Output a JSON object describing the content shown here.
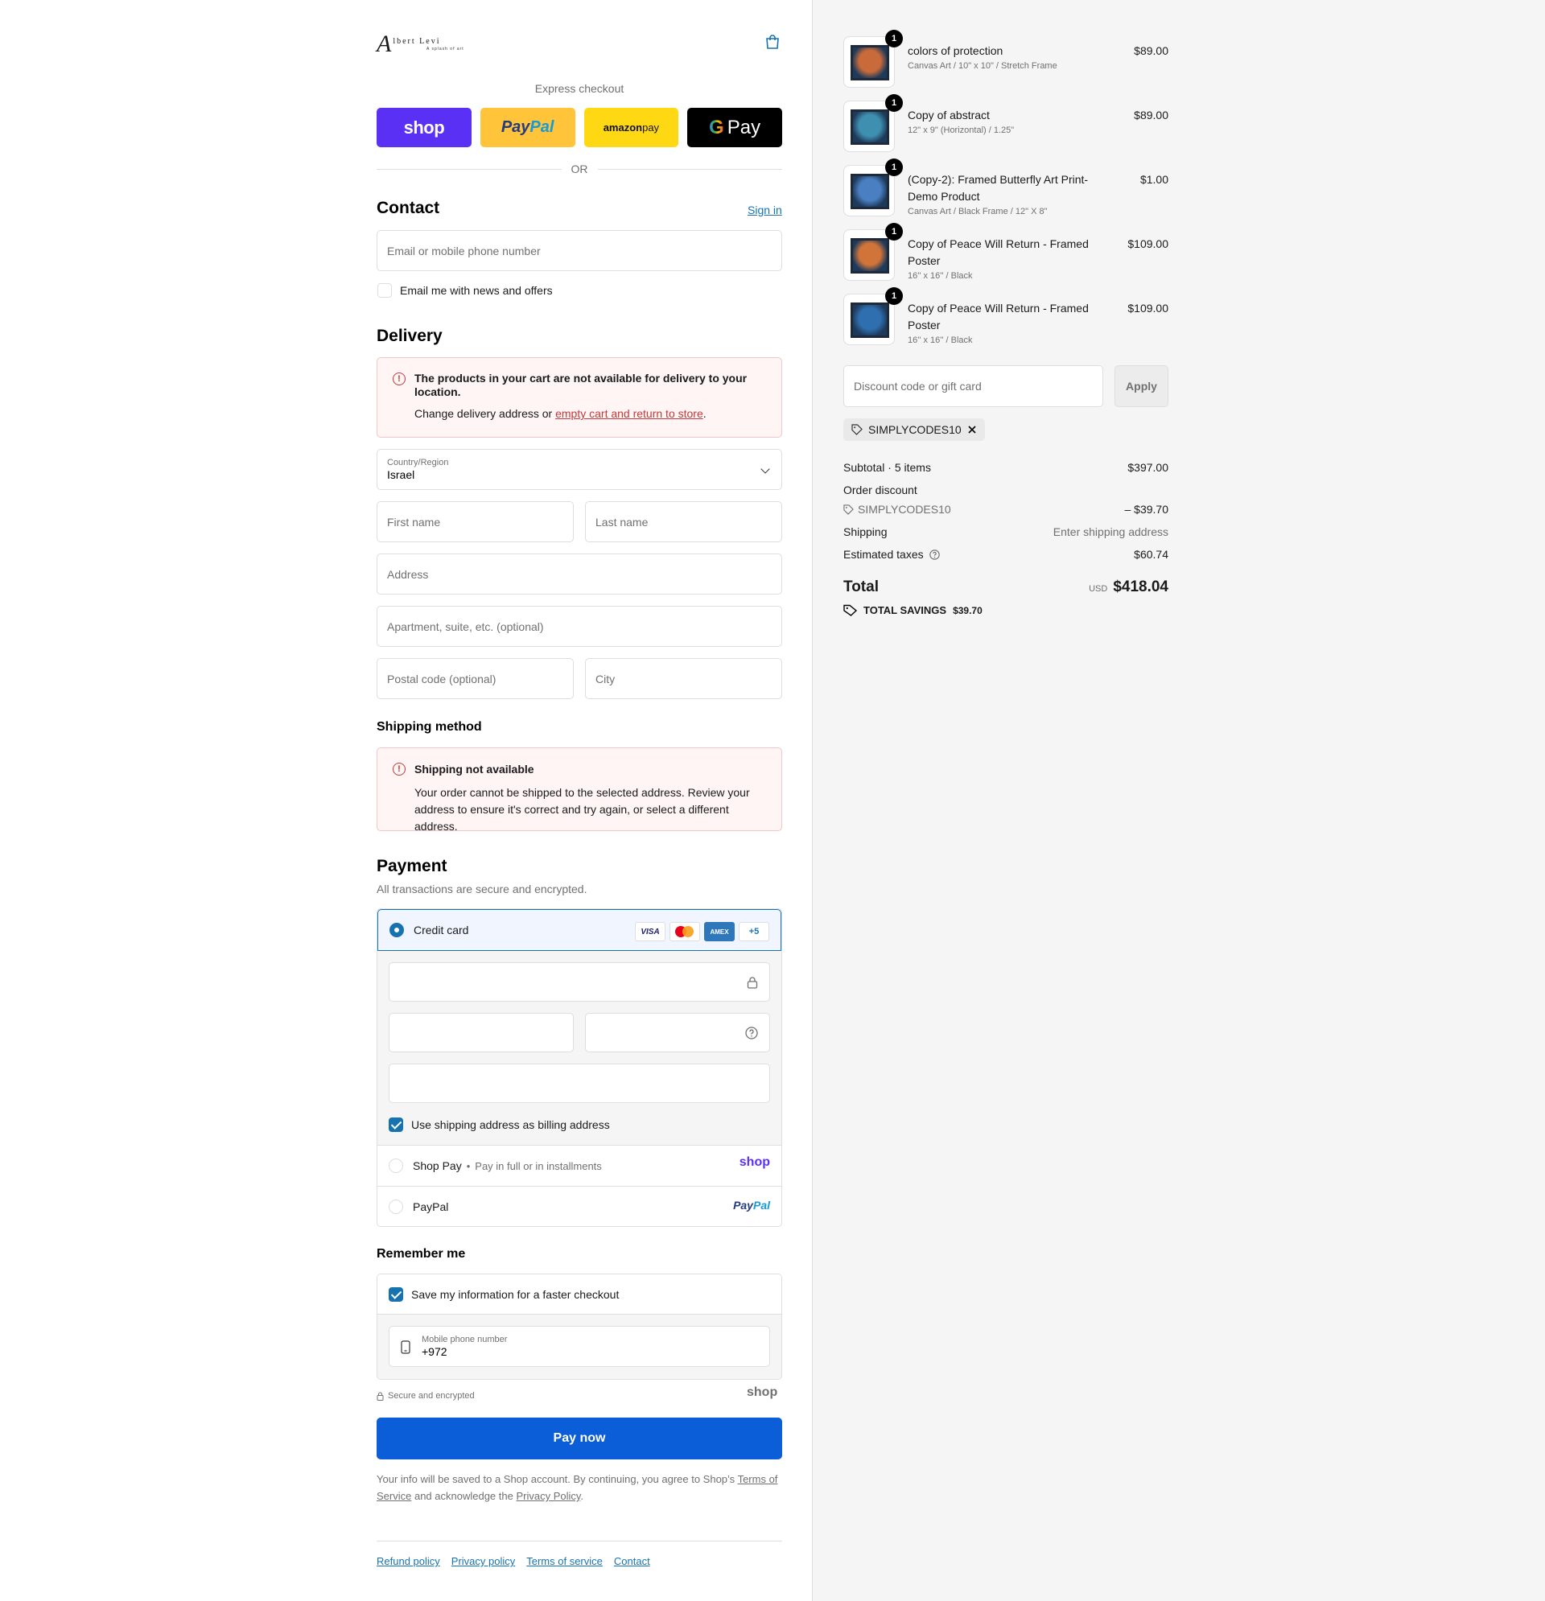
{
  "header": {
    "logo_mark": "A",
    "logo_text": "lbert Levi",
    "logo_tagline": "A splash of art"
  },
  "express": {
    "title": "Express checkout",
    "shop": "shop",
    "paypal_1": "Pay",
    "paypal_2": "Pal",
    "amazon_1": "amazon",
    "amazon_2": " pay",
    "gpay_g": "G",
    "gpay_label": "Pay",
    "or": "OR"
  },
  "contact": {
    "title": "Contact",
    "sign_in": "Sign in",
    "email_placeholder": "Email or mobile phone number",
    "newsletter": "Email me with news and offers"
  },
  "delivery": {
    "title": "Delivery",
    "alert_title": "The products in your cart are not available for delivery to your location.",
    "alert_text": "Change delivery address or ",
    "alert_link": "empty cart and return to store",
    "alert_end": ".",
    "country_label": "Country/Region",
    "country_value": "Israel",
    "first_name": "First name",
    "last_name": "Last name",
    "address": "Address",
    "apartment": "Apartment, suite, etc. (optional)",
    "postal": "Postal code (optional)",
    "city": "City"
  },
  "shipping": {
    "title": "Shipping method",
    "alert_title": "Shipping not available",
    "alert_text": "Your order cannot be shipped to the selected address. Review your address to ensure it's correct and try again, or select a different address."
  },
  "payment": {
    "title": "Payment",
    "subtitle": "All transactions are secure and encrypted.",
    "credit_card": "Credit card",
    "cards": {
      "visa": "VISA",
      "amex": "AMEX",
      "more": "+5"
    },
    "billing_same": "Use shipping address as billing address",
    "shop_pay": "Shop Pay",
    "shop_pay_sub": "Pay in full or in installments",
    "shop_pay_logo": "shop",
    "paypal": "PayPal",
    "paypal_logo_1": "Pay",
    "paypal_logo_2": "Pal"
  },
  "remember": {
    "title": "Remember me",
    "save_info": "Save my information for a faster checkout",
    "phone_label": "Mobile phone number",
    "phone_value": "+972",
    "secure": "Secure and encrypted",
    "shop_logo": "shop"
  },
  "pay_now": "Pay now",
  "legal": {
    "text_1": "Your info will be saved to a Shop account. By continuing, you agree to Shop’s ",
    "tos": "Terms of Service",
    "text_2": " and acknowledge the ",
    "privacy": "Privacy Policy",
    "text_3": "."
  },
  "footer": {
    "refund": "Refund policy",
    "privacy": "Privacy policy",
    "terms": "Terms of service",
    "contact": "Contact"
  },
  "cart": {
    "items": [
      {
        "qty": "1",
        "name": "colors of protection",
        "variant": "Canvas Art / 10\" x 10\" / Stretch Frame",
        "price": "$89.00",
        "color": "#c86a3a"
      },
      {
        "qty": "1",
        "name": "Copy of abstract",
        "variant": "12\" x 9\" (Horizontal) / 1.25\"",
        "price": "$89.00",
        "color": "#3f8fb0"
      },
      {
        "qty": "1",
        "name": "(Copy-2): Framed Butterfly Art Print- Demo Product",
        "variant": "Canvas Art / Black Frame / 12\" X 8\"",
        "price": "$1.00",
        "color": "#4a7fc2"
      },
      {
        "qty": "1",
        "name": "Copy of Peace Will Return - Framed Poster",
        "variant": "16'' x 16'' / Black",
        "price": "$109.00",
        "color": "#d0743a"
      },
      {
        "qty": "1",
        "name": "Copy of Peace Will Return - Framed Poster",
        "variant": "16'' x 16'' / Black",
        "price": "$109.00",
        "color": "#2f6fb0"
      }
    ],
    "discount_placeholder": "Discount code or gift card",
    "apply": "Apply",
    "code": "SIMPLYCODES10",
    "subtotal_label": "Subtotal · 5 items",
    "subtotal": "$397.00",
    "order_discount": "Order discount",
    "discount_code": "SIMPLYCODES10",
    "discount_value": "– $39.70",
    "shipping_label": "Shipping",
    "shipping_value": "Enter shipping address",
    "taxes_label": "Estimated taxes",
    "taxes_value": "$60.74",
    "total_label": "Total",
    "currency": "USD",
    "total": "$418.04",
    "savings_label": "TOTAL SAVINGS",
    "savings": "$39.70"
  }
}
